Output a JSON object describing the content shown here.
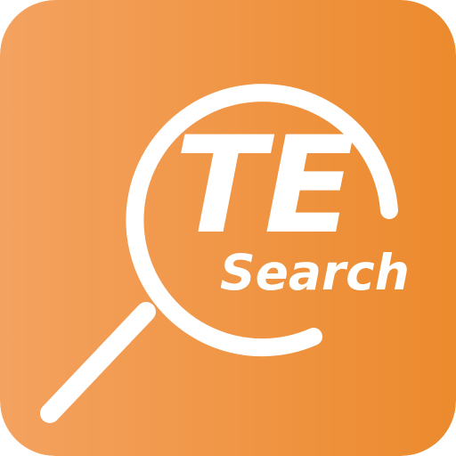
{
  "app_icon": {
    "logo_line1": "TE",
    "logo_line2": "Search",
    "icon": "magnifying-glass-icon",
    "colors": {
      "gradient_start": "#F4A260",
      "gradient_end": "#EC8A2D",
      "foreground": "#FFFFFF",
      "background": "#FFFFFF"
    }
  }
}
